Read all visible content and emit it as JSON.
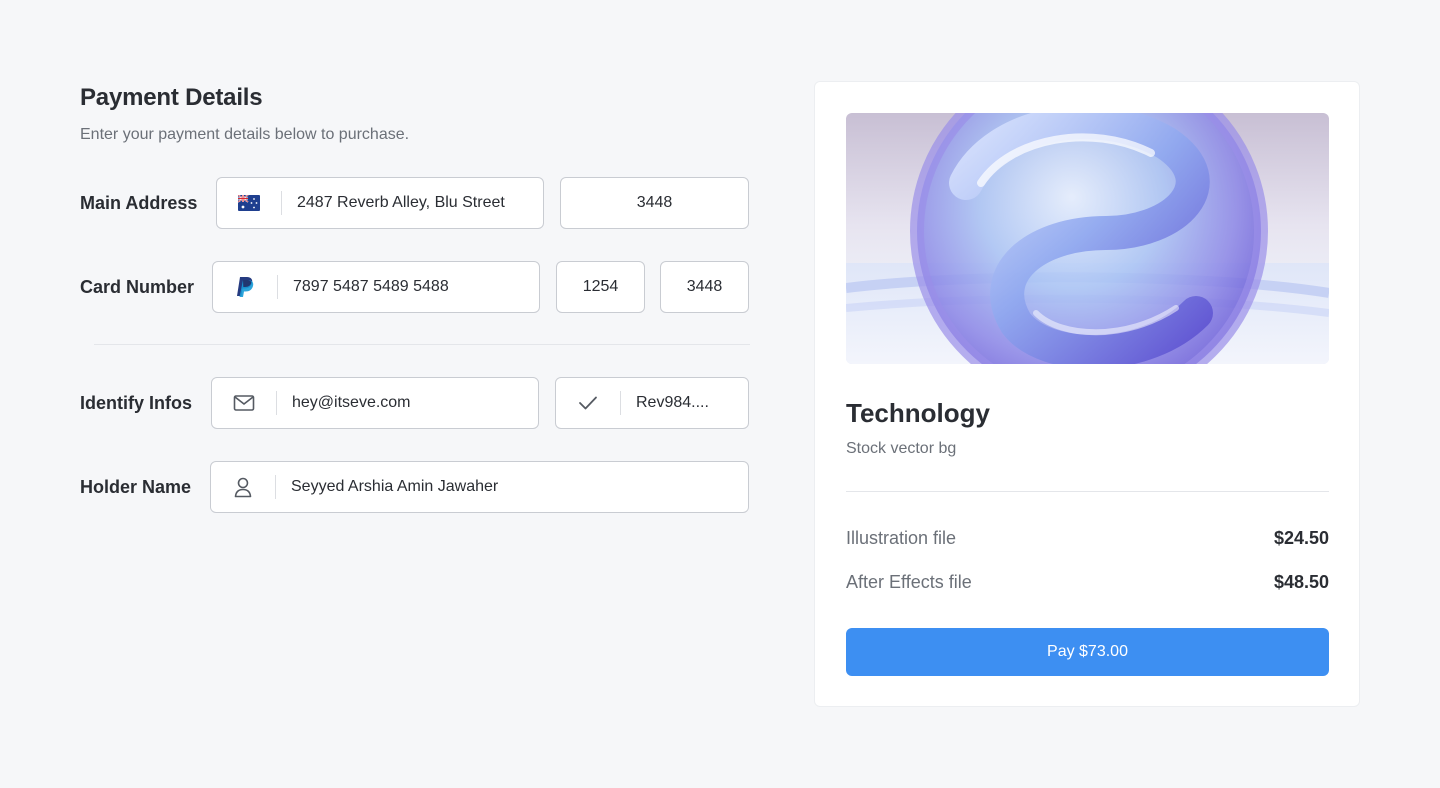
{
  "header": {
    "title": "Payment Details",
    "subtitle": "Enter your payment details below to purchase."
  },
  "form": {
    "main_address": {
      "label": "Main Address",
      "flag_icon": "australia-flag-icon",
      "street": "2487 Reverb Alley, Blu Street",
      "postcode": "3448"
    },
    "card_number": {
      "label": "Card Number",
      "brand_icon": "paypal-icon",
      "number": "7897 5487 5489 5488",
      "expiry": "1254",
      "cvv": "3448"
    },
    "identify_infos": {
      "label": "Identify Infos",
      "email_icon": "mail-icon",
      "email": "hey@itseve.com",
      "check_icon": "check-icon",
      "id_value": "Rev984...."
    },
    "holder_name": {
      "label": "Holder Name",
      "user_icon": "user-icon",
      "name": "Seyyed Arshia Amin Jawaher"
    }
  },
  "summary": {
    "product_title": "Technology",
    "product_subtitle": "Stock vector bg",
    "items": [
      {
        "name": "Illustration file",
        "price": "$24.50"
      },
      {
        "name": "After Effects file",
        "price": "$48.50"
      }
    ],
    "pay_label": "Pay $73.00"
  },
  "colors": {
    "accent": "#3d8ff2",
    "background": "#f6f7f9",
    "text": "#2a2d33",
    "muted": "#6b7078"
  }
}
